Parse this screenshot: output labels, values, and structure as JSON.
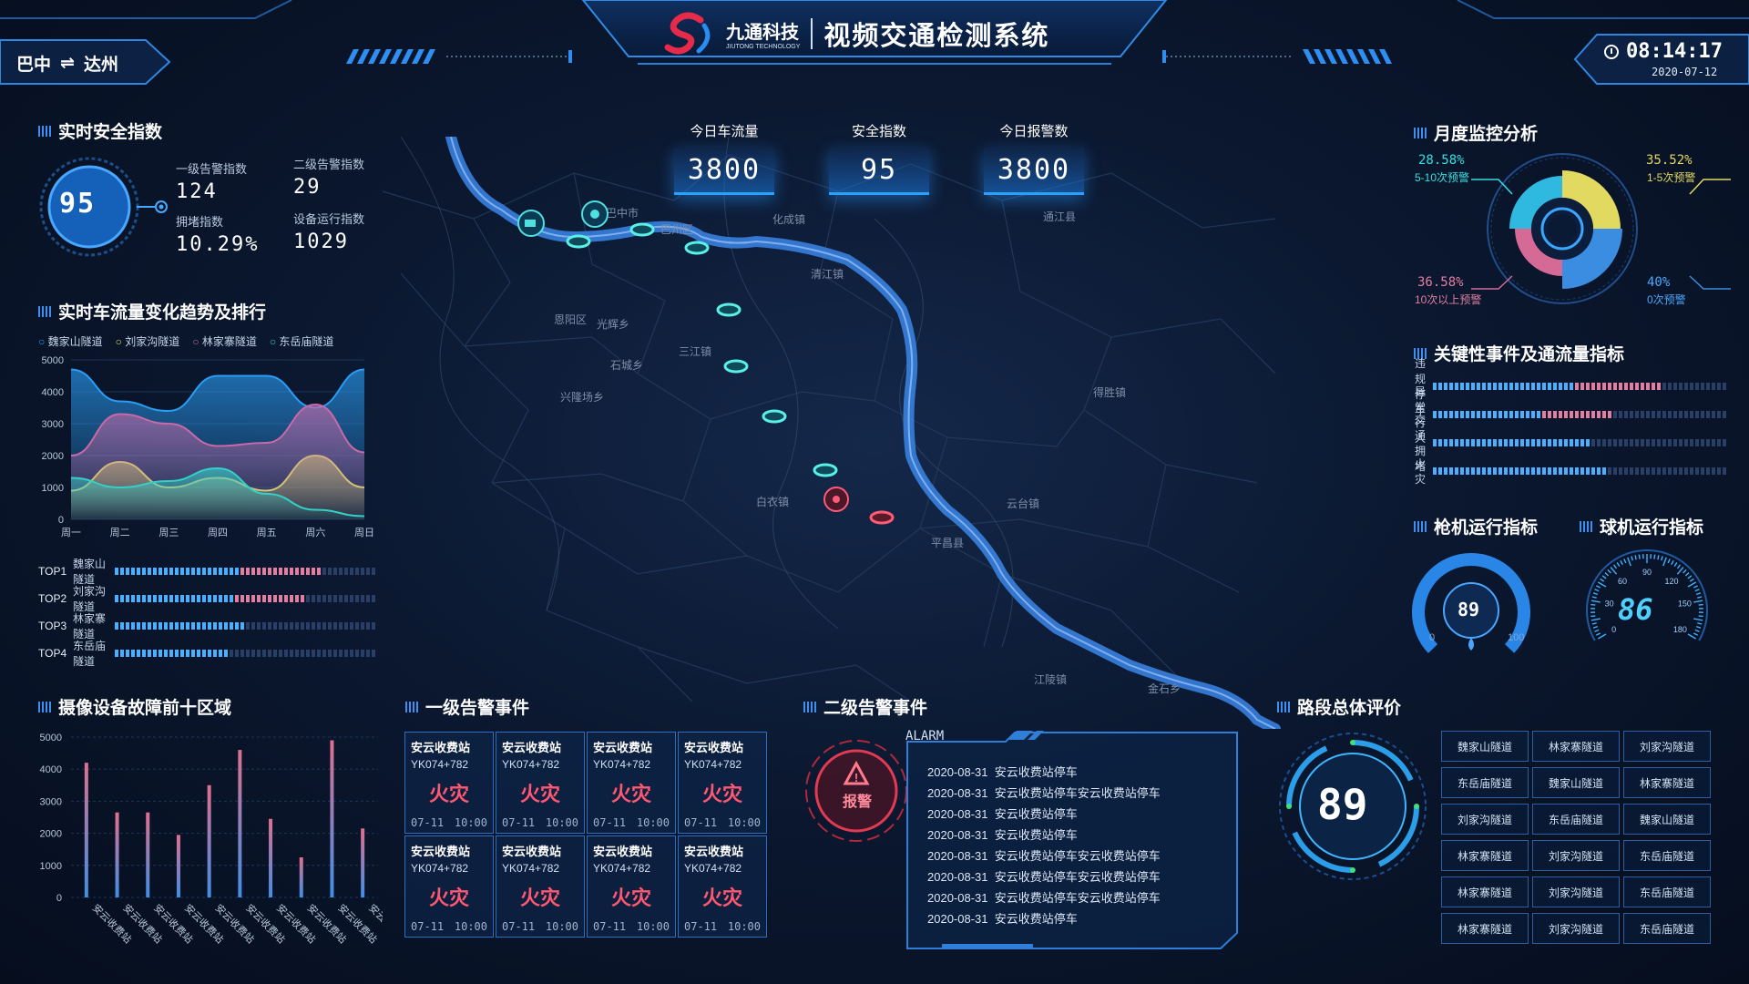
{
  "header": {
    "brand_name": "九通科技",
    "brand_sub": "JIUTONG TECHNOLOGY",
    "system_title": "视频交通检测系统",
    "route_from": "巴中",
    "route_arrow": "⇌",
    "route_to": "达州",
    "time": "08:14:17",
    "date": "2020-07-12"
  },
  "safety": {
    "title": "实时安全指数",
    "score": "95",
    "l1_label": "一级告警指数",
    "l1_value": "124",
    "l2_label": "二级告警指数",
    "l2_value": "29",
    "jam_label": "拥堵指数",
    "jam_value": "10.29%",
    "dev_label": "设备运行指数",
    "dev_value": "1029"
  },
  "traffic": {
    "title": "实时车流量变化趋势及排行",
    "legend": [
      "魏家山隧道",
      "刘家沟隧道",
      "林家寨隧道",
      "东岳庙隧道"
    ],
    "rank": [
      {
        "top": "TOP1",
        "name": "魏家山隧道"
      },
      {
        "top": "TOP2",
        "name": "刘家沟隧道"
      },
      {
        "top": "TOP3",
        "name": "林家寨隧道"
      },
      {
        "top": "TOP4",
        "name": "东岳庙隧道"
      }
    ]
  },
  "chart_data": [
    {
      "type": "area",
      "categories": [
        "周一",
        "周二",
        "周三",
        "周四",
        "周五",
        "周六",
        "周日"
      ],
      "ylim": [
        0,
        5000
      ],
      "yticks": [
        "0",
        "1000",
        "2000",
        "3000",
        "4000",
        "5000"
      ],
      "series": [
        {
          "name": "魏家山隧道",
          "color": "#2a9df4",
          "values": [
            4700,
            3700,
            3400,
            4500,
            4500,
            3500,
            4700
          ]
        },
        {
          "name": "刘家沟隧道",
          "color": "#d6dc6a",
          "values": [
            900,
            1800,
            1000,
            1300,
            900,
            2000,
            1000
          ]
        },
        {
          "name": "林家寨隧道",
          "color": "#c76aa8",
          "values": [
            2000,
            3300,
            3000,
            2300,
            2400,
            3600,
            2100
          ]
        },
        {
          "name": "东岳庙隧道",
          "color": "#33d0c8",
          "values": [
            1300,
            1000,
            1200,
            1600,
            800,
            300,
            100
          ]
        }
      ]
    },
    {
      "type": "bar",
      "categories": [
        "安云收费站",
        "安云收费站",
        "安云收费站",
        "安云收费站",
        "安云收费站",
        "安云收费站",
        "安云收费站",
        "安云收费站",
        "安云收费站",
        "安云收费站"
      ],
      "ylim": [
        0,
        5000
      ],
      "yticks": [
        "0",
        "1000",
        "2000",
        "3000",
        "4000",
        "5000"
      ],
      "values": [
        4200,
        2650,
        2650,
        1950,
        3500,
        4600,
        2450,
        1250,
        4900,
        2150
      ]
    },
    {
      "type": "pie",
      "slices": [
        {
          "label": "1-5次预警",
          "percent": "35.52%",
          "color": "#e2d960"
        },
        {
          "label": "0次预警",
          "percent": "40%",
          "color": "#3a8de0"
        },
        {
          "label": "10次以上预警",
          "percent": "36.58%",
          "color": "#d46a95"
        },
        {
          "label": "5-10次预警",
          "percent": "28.58%",
          "color": "#2fb8e0"
        }
      ]
    }
  ],
  "devices": {
    "title": "摄像设备故障前十区域"
  },
  "alarm1": {
    "title": "一级告警事件",
    "cards": [
      {
        "station": "安云收费站",
        "km": "YK074+782",
        "type": "火灾",
        "date": "07-11",
        "time": "10:00"
      },
      {
        "station": "安云收费站",
        "km": "YK074+782",
        "type": "火灾",
        "date": "07-11",
        "time": "10:00"
      },
      {
        "station": "安云收费站",
        "km": "YK074+782",
        "type": "火灾",
        "date": "07-11",
        "time": "10:00"
      },
      {
        "station": "安云收费站",
        "km": "YK074+782",
        "type": "火灾",
        "date": "07-11",
        "time": "10:00"
      },
      {
        "station": "安云收费站",
        "km": "YK074+782",
        "type": "火灾",
        "date": "07-11",
        "time": "10:00"
      },
      {
        "station": "安云收费站",
        "km": "YK074+782",
        "type": "火灾",
        "date": "07-11",
        "time": "10:00"
      },
      {
        "station": "安云收费站",
        "km": "YK074+782",
        "type": "火灾",
        "date": "07-11",
        "time": "10:00"
      },
      {
        "station": "安云收费站",
        "km": "YK074+782",
        "type": "火灾",
        "date": "07-11",
        "time": "10:00"
      }
    ]
  },
  "alarm2": {
    "title": "二级告警事件",
    "alarm_label": "ALARM",
    "badge": "报警",
    "rows": [
      {
        "date": "2020-08-31",
        "text": "安云收费站停车"
      },
      {
        "date": "2020-08-31",
        "text": "安云收费站停车安云收费站停车"
      },
      {
        "date": "2020-08-31",
        "text": "安云收费站停车"
      },
      {
        "date": "2020-08-31",
        "text": "安云收费站停车"
      },
      {
        "date": "2020-08-31",
        "text": "安云收费站停车安云收费站停车"
      },
      {
        "date": "2020-08-31",
        "text": "安云收费站停车安云收费站停车"
      },
      {
        "date": "2020-08-31",
        "text": "安云收费站停车安云收费站停车"
      },
      {
        "date": "2020-08-31",
        "text": "安云收费站停车"
      }
    ]
  },
  "kpis": [
    {
      "label": "今日车流量",
      "value": "3800"
    },
    {
      "label": "安全指数",
      "value": "95"
    },
    {
      "label": "今日报警数",
      "value": "3800"
    }
  ],
  "monthly": {
    "title": "月度监控分析",
    "p1": "28.58%",
    "l1": "5-10次预警",
    "p2": "35.52%",
    "l2": "1-5次预警",
    "p3": "36.58%",
    "l3": "10次以上预警",
    "p4": "40%",
    "l4": "0次预警"
  },
  "key_events": {
    "title": "关键性事件及通流量指标",
    "items": [
      {
        "label": "违规停车",
        "level": 0.78
      },
      {
        "label": "异常行人",
        "level": 0.62
      },
      {
        "label": "交通拥堵",
        "level": 0.53
      },
      {
        "label": "火灾",
        "level": 0.6
      }
    ]
  },
  "gun": {
    "title": "枪机运行指标",
    "value": "89",
    "min": "0",
    "max": "100"
  },
  "dome": {
    "title": "球机运行指标",
    "value": "86",
    "ticks": [
      "0",
      "30",
      "60",
      "90",
      "120",
      "150",
      "180"
    ]
  },
  "road": {
    "title": "路段总体评价",
    "score": "89",
    "grid": [
      "魏家山隧道",
      "林家寨隧道",
      "刘家沟隧道",
      "东岳庙隧道",
      "魏家山隧道",
      "林家寨隧道",
      "刘家沟隧道",
      "东岳庙隧道",
      "魏家山隧道",
      "林家寨隧道",
      "刘家沟隧道",
      "东岳庙隧道",
      "林家寨隧道",
      "刘家沟隧道",
      "东岳庙隧道",
      "林家寨隧道",
      "刘家沟隧道",
      "东岳庙隧道"
    ]
  },
  "map": {
    "labels": [
      "巴中市",
      "巴州区",
      "恩阳区",
      "平昌县",
      "通江县",
      "化成镇",
      "清江镇",
      "三江镇",
      "石城乡",
      "江陵镇",
      "金石乡",
      "云台镇",
      "得胜镇",
      "白衣镇",
      "光辉乡",
      "兴隆场乡"
    ]
  }
}
